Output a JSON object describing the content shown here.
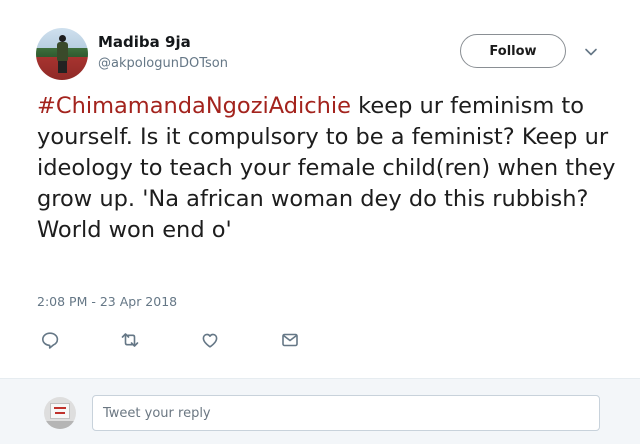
{
  "author": {
    "display_name": "Madiba 9ja",
    "screen_name": "@akpologunDOTson"
  },
  "follow_button": {
    "label": "Follow"
  },
  "tweet": {
    "hashtag": "#ChimamandaNgoziAdichie",
    "text_after_hashtag": " keep ur feminism to yourself. Is it compulsory to be a feminist? Keep ur ideology to teach your female child(ren) when they grow up. 'Na african woman dey do this rubbish?  World won end o'",
    "timestamp": "2:08 PM - 23 Apr 2018"
  },
  "actions": {
    "icons": [
      "reply-icon",
      "retweet-icon",
      "like-icon",
      "direct-message-icon"
    ]
  },
  "reply": {
    "placeholder": "Tweet your reply"
  },
  "colors": {
    "hashtag": "#a3231d",
    "secondary_text": "#657786",
    "icon": "#657786",
    "reply_bar_bg": "#f3f6f9"
  }
}
